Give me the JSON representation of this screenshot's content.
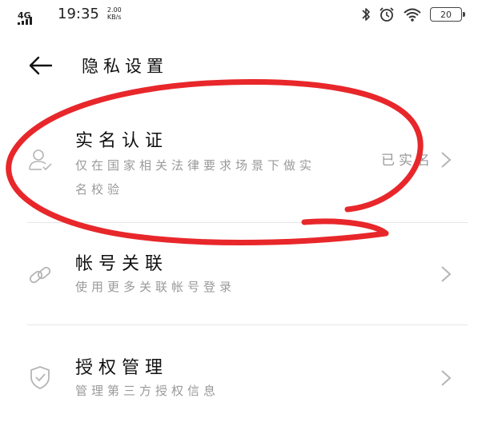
{
  "status_bar": {
    "network": "4G",
    "time": "19:35",
    "speed_value": "2.00",
    "speed_unit": "KB/s",
    "battery": "20"
  },
  "header": {
    "title": "隐私设置"
  },
  "rows": [
    {
      "title": "实名认证",
      "desc": "仅在国家相关法律要求场景下做实名校验",
      "value": "已实名",
      "icon": "user-verified-icon"
    },
    {
      "title": "帐号关联",
      "desc": "使用更多关联帐号登录",
      "icon": "link-icon"
    },
    {
      "title": "授权管理",
      "desc": "管理第三方授权信息",
      "icon": "shield-check-icon"
    }
  ],
  "colors": {
    "annotation": "#e8272b",
    "secondary_text": "#9a9a9a"
  }
}
